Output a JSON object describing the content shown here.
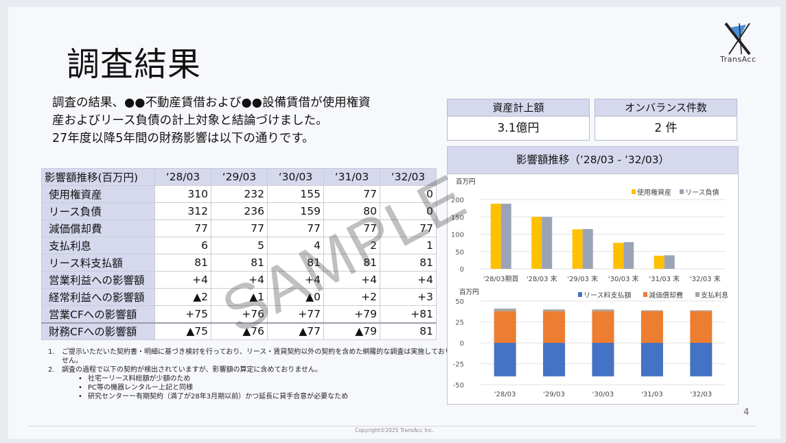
{
  "title": "調査結果",
  "logo_text": "TransAcc",
  "intro": [
    "調査の結果、●●不動産賃借および●●設備賃借が使用権資",
    "産およびリース負債の計上対象と結論づけました。",
    "27年度以降5年間の財務影響は以下の通りです。"
  ],
  "kpis": [
    {
      "label": "資産計上額",
      "value": "3.1億円"
    },
    {
      "label": "オンバランス件数",
      "value": "2 件"
    }
  ],
  "table": {
    "header": "影響額推移(百万円)",
    "columns": [
      "‘28/03",
      "‘29/03",
      "‘30/03",
      "‘31/03",
      "‘32/03"
    ],
    "rows": [
      {
        "label": "使用権資産",
        "values": [
          "310",
          "232",
          "155",
          "77",
          "0"
        ]
      },
      {
        "label": "リース負債",
        "values": [
          "312",
          "236",
          "159",
          "80",
          "0"
        ]
      },
      {
        "label": "減価償却費",
        "values": [
          "77",
          "77",
          "77",
          "77",
          "77"
        ]
      },
      {
        "label": "支払利息",
        "values": [
          "6",
          "5",
          "4",
          "2",
          "1"
        ]
      },
      {
        "label": "リース料支払額",
        "values": [
          "81",
          "81",
          "81",
          "81",
          "81"
        ]
      },
      {
        "label": "営業利益への影響額",
        "values": [
          "+4",
          "+4",
          "+4",
          "+4",
          "+4"
        ]
      },
      {
        "label": "経常利益への影響額",
        "values": [
          "▲2",
          "▲1",
          "▲0",
          "+2",
          "+3"
        ]
      },
      {
        "label": "営業CFへの影響額",
        "values": [
          "+75",
          "+76",
          "+77",
          "+79",
          "+81"
        ]
      },
      {
        "label": "財務CFへの影響額",
        "values": [
          "▲75",
          "▲76",
          "▲77",
          "▲79",
          "81"
        ]
      }
    ]
  },
  "notes": {
    "items": [
      {
        "no": "1.",
        "text": "ご提示いただいた契約書・明細に基づき検討を行っており、リース・賃貸契約以外の契約を含めた網羅的な調査は実施しておりません。"
      },
      {
        "no": "2.",
        "text": "調査の過程で以下の契約が検出されていますが、影響額の算定に含めておりません。"
      }
    ],
    "subitems": [
      "社宅ーリース料総額が少額のため",
      "PC等の機器レンタルー上記と同様",
      "研究センターー有期契約（満了が28年3月期以前）かつ延長に貸手合意が必要なため"
    ]
  },
  "watermark": "SAMPLE",
  "chart_panel_title": "影響額推移（’28/03 - ’32/03）",
  "page_number": "4",
  "copyright": "Copyright©2025 TransAcc Inc.",
  "colors": {
    "yellow": "#ffc000",
    "gray": "#9aa4b6",
    "blue": "#4472c4",
    "orange": "#ed7d31",
    "tan": "#a5a5a5",
    "header_bg": "#d6d9ee"
  },
  "chart_data": [
    {
      "type": "bar",
      "unit_label": "百万円",
      "categories": [
        "'28/03期首",
        "'28/03 末",
        "'29/03 末",
        "'30/03 末",
        "'31/03 末",
        "'32/03 末"
      ],
      "series": [
        {
          "name": "使用権資産",
          "values": [
            188,
            150,
            114,
            75,
            38,
            0
          ]
        },
        {
          "name": "リース負債",
          "values": [
            188,
            150,
            115,
            77,
            39,
            0
          ]
        }
      ],
      "ylim": [
        0,
        200
      ],
      "yticks": [
        0,
        50,
        100,
        150,
        200
      ],
      "legend": "top-right"
    },
    {
      "type": "bar",
      "stacked": true,
      "unit_label": "百万円",
      "categories": [
        "'28/03",
        "'29/03",
        "'30/03",
        "'31/03",
        "'32/03"
      ],
      "series": [
        {
          "name": "リース料支払額",
          "values": [
            -40,
            -40,
            -40,
            -40,
            -40
          ]
        },
        {
          "name": "減価償却費",
          "values": [
            38,
            38,
            38,
            38,
            38
          ]
        },
        {
          "name": "支払利息",
          "values": [
            3,
            2,
            2,
            1,
            1
          ]
        }
      ],
      "ylim": [
        -50,
        50
      ],
      "yticks": [
        -50,
        -25,
        0,
        25,
        50
      ],
      "legend": "top-right"
    }
  ]
}
